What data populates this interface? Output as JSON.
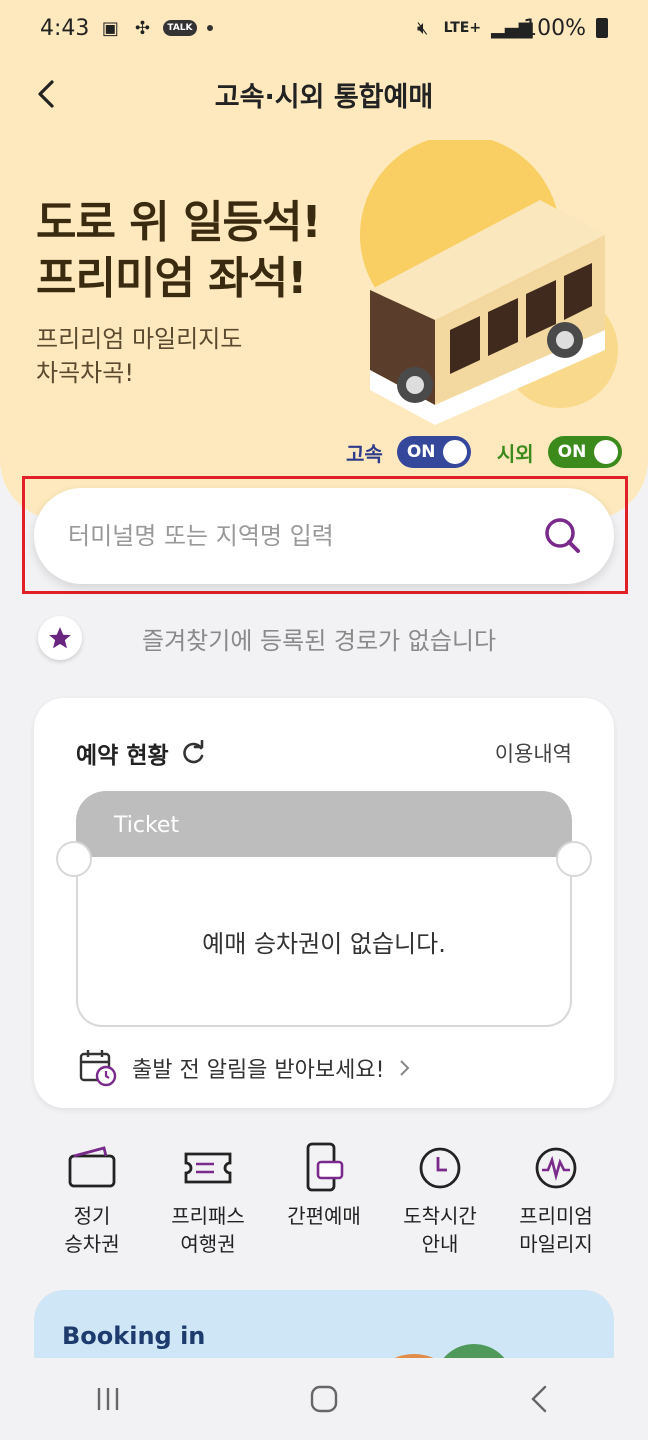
{
  "status_bar": {
    "time": "4:43",
    "talk_badge": "TALK",
    "network": "LTE+",
    "battery": "100%"
  },
  "header": {
    "title": "고속·시외 통합예매"
  },
  "hero": {
    "headline_line1": "도로 위 일등석!",
    "headline_line2": "프리미엄 좌석!",
    "sub_line1": "프리리엄 마일리지도",
    "sub_line2": "차곡차곡!"
  },
  "toggles": [
    {
      "label": "고속",
      "state": "ON",
      "color": "#34479a"
    },
    {
      "label": "시외",
      "state": "ON",
      "color": "#3c8a1c"
    }
  ],
  "search": {
    "placeholder": "터미널명 또는 지역명 입력",
    "value": ""
  },
  "favorites": {
    "empty_text": "즐겨찾기에 등록된 경로가 없습니다"
  },
  "reservation": {
    "title": "예약 현황",
    "history_link": "이용내역",
    "ticket_label": "Ticket",
    "empty_text": "예매 승차권이 없습니다.",
    "alert_text": "출발 전 알림을 받아보세요!"
  },
  "quick_menu": [
    {
      "label": "정기\n승차권",
      "icon": "wallet-icon"
    },
    {
      "label": "프리패스\n여행권",
      "icon": "freepass-ticket-icon"
    },
    {
      "label": "간편예매",
      "icon": "mobile-ticket-icon"
    },
    {
      "label": "도착시간\n안내",
      "icon": "clock-icon"
    },
    {
      "label": "프리미엄\n마일리지",
      "icon": "mileage-icon"
    }
  ],
  "banner": {
    "title": "Booking in"
  },
  "colors": {
    "hero_bg": "#fde9bd",
    "accent_purple": "#7a2a8a",
    "highlight_red": "#e01f26"
  }
}
